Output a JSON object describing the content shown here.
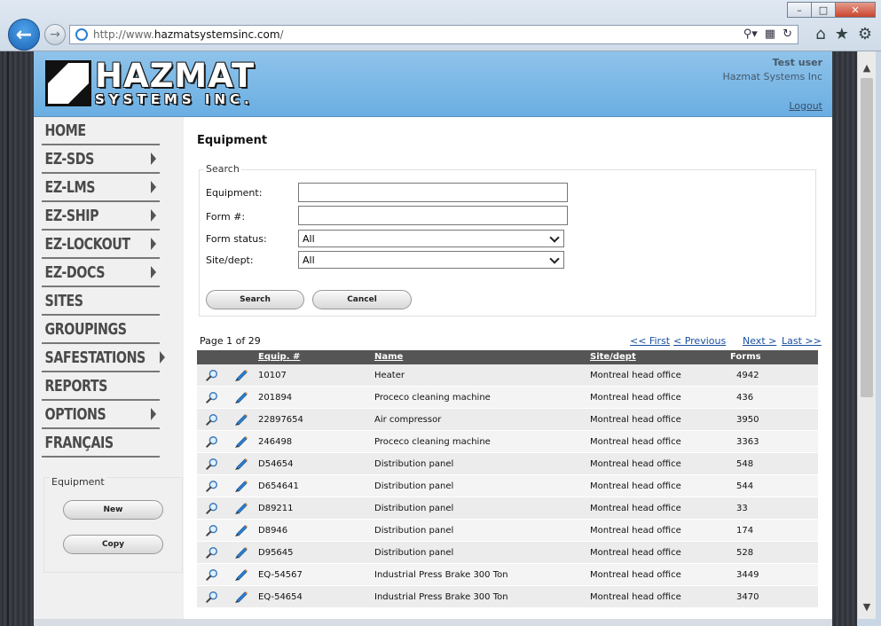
{
  "browser": {
    "url_prefix": "http://www.",
    "url_domain": "hazmatsystemsinc.com",
    "url_suffix": "/"
  },
  "header": {
    "logo_line1": "HAZMAT",
    "logo_line2": "SYSTEMS INC.",
    "user_name": "Test user",
    "company": "Hazmat Systems Inc",
    "logout": "Logout"
  },
  "nav": [
    {
      "label": "HOME",
      "arrow": false
    },
    {
      "label": "EZ-SDS",
      "arrow": true
    },
    {
      "label": "EZ-LMS",
      "arrow": true
    },
    {
      "label": "EZ-SHIP",
      "arrow": true
    },
    {
      "label": "EZ-LOCKOUT",
      "arrow": true
    },
    {
      "label": "EZ-DOCS",
      "arrow": true
    },
    {
      "label": "SITES",
      "arrow": false
    },
    {
      "label": "GROUPINGS",
      "arrow": false
    },
    {
      "label": "SAFESTATIONS",
      "arrow": true
    },
    {
      "label": "REPORTS",
      "arrow": false
    },
    {
      "label": "OPTIONS",
      "arrow": true
    },
    {
      "label": "FRANÇAIS",
      "arrow": false
    }
  ],
  "side_panel": {
    "title": "Equipment",
    "new_label": "New",
    "copy_label": "Copy"
  },
  "main": {
    "title": "Equipment",
    "search": {
      "legend": "Search",
      "equipment_label": "Equipment:",
      "equipment_value": "",
      "form_label": "Form #:",
      "form_value": "",
      "status_label": "Form status:",
      "status_value": "All",
      "site_label": "Site/dept:",
      "site_value": "All",
      "search_button": "Search",
      "cancel_button": "Cancel"
    },
    "paging": {
      "info": "Page 1 of 29",
      "first": "<< First",
      "previous": "< Previous",
      "next": "Next >",
      "last": "Last >>"
    },
    "columns": {
      "equip": "Equip. #",
      "name": "Name",
      "site": "Site/dept",
      "forms": "Forms"
    },
    "rows": [
      {
        "equip": "10107",
        "name": "Heater",
        "site": "Montreal head office",
        "forms": "4942"
      },
      {
        "equip": "201894",
        "name": "Proceco cleaning machine",
        "site": "Montreal head office",
        "forms": "436"
      },
      {
        "equip": "22897654",
        "name": "Air compressor",
        "site": "Montreal head office",
        "forms": "3950"
      },
      {
        "equip": "246498",
        "name": "Proceco cleaning machine",
        "site": "Montreal head office",
        "forms": "3363"
      },
      {
        "equip": "D54654",
        "name": "Distribution panel",
        "site": "Montreal head office",
        "forms": "548"
      },
      {
        "equip": "D654641",
        "name": "Distribution panel",
        "site": "Montreal head office",
        "forms": "544"
      },
      {
        "equip": "D89211",
        "name": "Distribution panel",
        "site": "Montreal head office",
        "forms": "33"
      },
      {
        "equip": "D8946",
        "name": "Distribution panel",
        "site": "Montreal head office",
        "forms": "174"
      },
      {
        "equip": "D95645",
        "name": "Distribution panel",
        "site": "Montreal head office",
        "forms": "528"
      },
      {
        "equip": "EQ-54567",
        "name": "Industrial Press Brake 300 Ton",
        "site": "Montreal head office",
        "forms": "3449"
      },
      {
        "equip": "EQ-54654",
        "name": "Industrial Press Brake 300 Ton",
        "site": "Montreal head office",
        "forms": "3470"
      }
    ]
  }
}
